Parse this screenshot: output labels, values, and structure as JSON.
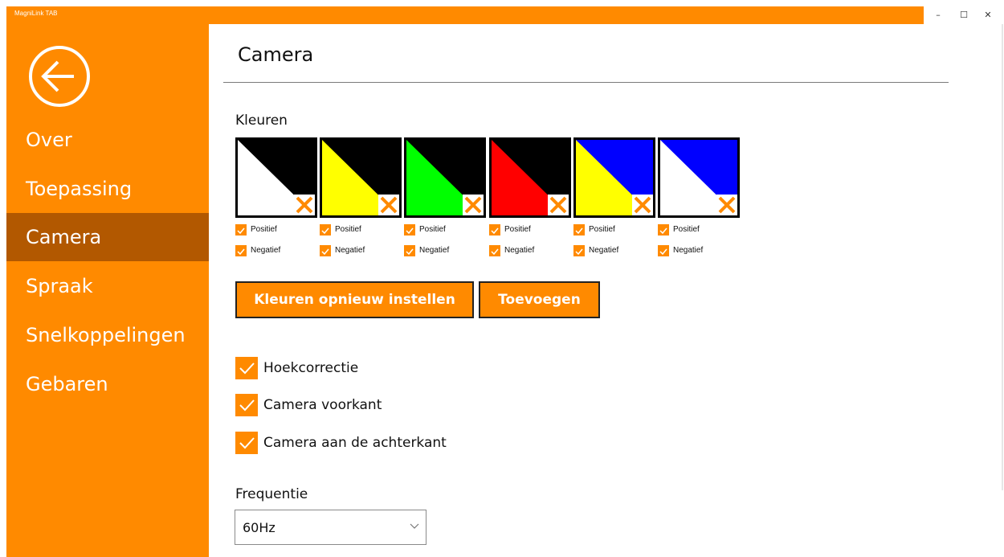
{
  "window": {
    "title": "MagniLink TAB",
    "minimize": "–",
    "maximize": "☐",
    "close": "✕"
  },
  "sidebar": {
    "back_icon": "back-arrow-circle-icon",
    "items": [
      {
        "label": "Over"
      },
      {
        "label": "Toepassing"
      },
      {
        "label": "Camera",
        "active": true
      },
      {
        "label": "Spraak"
      },
      {
        "label": "Snelkoppelingen"
      },
      {
        "label": "Gebaren"
      }
    ]
  },
  "main": {
    "title": "Camera",
    "colors_label": "Kleuren",
    "swatches": [
      {
        "bg": "#000000",
        "fg": "#ffffff",
        "positive": "Positief",
        "negative": "Negatief"
      },
      {
        "bg": "#000000",
        "fg": "#ffff00",
        "positive": "Positief",
        "negative": "Negatief"
      },
      {
        "bg": "#000000",
        "fg": "#00ff00",
        "positive": "Positief",
        "negative": "Negatief"
      },
      {
        "bg": "#000000",
        "fg": "#ff0000",
        "positive": "Positief",
        "negative": "Negatief"
      },
      {
        "bg": "#0000ff",
        "fg": "#ffff00",
        "positive": "Positief",
        "negative": "Negatief"
      },
      {
        "bg": "#0000ff",
        "fg": "#ffffff",
        "positive": "Positief",
        "negative": "Negatief"
      }
    ],
    "reset_button": "Kleuren opnieuw instellen",
    "add_button": "Toevoegen",
    "checkboxes": [
      {
        "label": "Hoekcorrectie",
        "checked": true
      },
      {
        "label": "Camera voorkant",
        "checked": true
      },
      {
        "label": "Camera aan de achterkant",
        "checked": true
      }
    ],
    "frequency_label": "Frequentie",
    "frequency_value": "60Hz"
  },
  "colors": {
    "accent": "#ff8a00",
    "accent_active": "#b25800"
  }
}
